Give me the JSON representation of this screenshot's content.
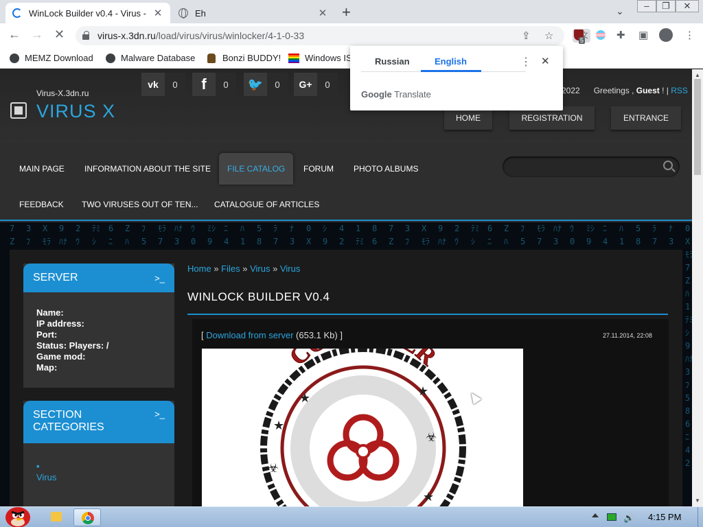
{
  "browser": {
    "tabs": [
      {
        "title": "WinLock Builder v0.4 - Virus -",
        "state": "loading"
      },
      {
        "title": "Eh",
        "state": "idle"
      }
    ],
    "new_tab": "+",
    "url_domain": "virus-x.3dn.ru",
    "url_path": "/load/virus/virus/winlocker/4-1-0-33",
    "extension_badge": "5",
    "bookmarks": [
      "MEMZ Download",
      "Malware Database",
      "Bonzi BUDDY!",
      "Windows IS"
    ]
  },
  "translate_popup": {
    "source_lang": "Russian",
    "target_lang": "English",
    "brand": "Google",
    "brand_suffix": "Translate"
  },
  "site": {
    "domain_label": "Virus-X.3dn.ru",
    "logo": "VIRUS X",
    "social": [
      {
        "icon": "vk",
        "count": "0"
      },
      {
        "icon": "facebook",
        "count": "0"
      },
      {
        "icon": "twitter",
        "count": "0"
      },
      {
        "icon": "google-plus",
        "count": "0"
      }
    ],
    "year_fragment": "2022",
    "greeting": "Greetings ,",
    "guest": "Guest",
    "greet_suffix": "! |",
    "rss": "RSS",
    "header_buttons": [
      "HOME",
      "REGISTRATION",
      "ENTRANCE"
    ],
    "nav_row1": [
      "MAIN PAGE",
      "INFORMATION ABOUT THE SITE",
      "FILE CATALOG",
      "FORUM",
      "PHOTO ALBUMS"
    ],
    "nav_row2": [
      "FEEDBACK",
      "TWO VIRUSES OUT OF TEN...",
      "CATALOGUE OF ARTICLES"
    ],
    "active_nav": "FILE CATALOG",
    "search_placeholder": ""
  },
  "sidebar": {
    "server": {
      "title": "SERVER",
      "prompt": ">_",
      "fields": [
        "Name:",
        "IP address:",
        "Port:",
        "Status: Players: /",
        "Game mod:",
        "Map:"
      ]
    },
    "categories": {
      "title_line1": "SECTION",
      "title_line2": "CATEGORIES",
      "prompt": ">_",
      "items": [
        "Virus"
      ]
    }
  },
  "article": {
    "breadcrumb": [
      "Home",
      "Files",
      "Virus",
      "Virus"
    ],
    "breadcrumb_sep": "»",
    "title": "WINLOCK BUILDER V0.4",
    "download_open": "[",
    "download_link": "Download from server",
    "download_size": "(653.1 Kb) ]",
    "date": "27.11.2014, 22:08",
    "image_text": "COMPUTER"
  },
  "taskbar": {
    "clock": "4:15 PM"
  },
  "colors": {
    "accent": "#1c8fd2",
    "link": "#2ba6de",
    "page_bg": "#2b2b2b"
  }
}
